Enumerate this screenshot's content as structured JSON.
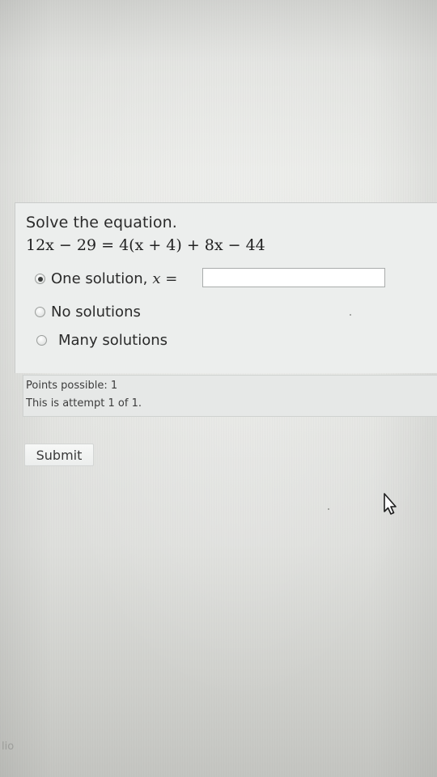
{
  "question": {
    "prompt": "Solve the equation.",
    "equation": "12x − 29 = 4(x + 4) + 8x − 44",
    "options": [
      {
        "label": "One solution, ",
        "var_suffix": "x =",
        "selected": true
      },
      {
        "label": "No solutions",
        "selected": false
      },
      {
        "label": "Many solutions",
        "selected": false
      }
    ],
    "answer": {
      "value": "",
      "placeholder": ""
    }
  },
  "info": {
    "points": "Points possible: 1",
    "attempt": "This is attempt 1 of 1."
  },
  "actions": {
    "submit_label": "Submit"
  },
  "corner_text": "lio",
  "colors": {
    "panel_bg": "#eceeed",
    "text": "#2a2a2a",
    "input_border": "#a9acab"
  }
}
